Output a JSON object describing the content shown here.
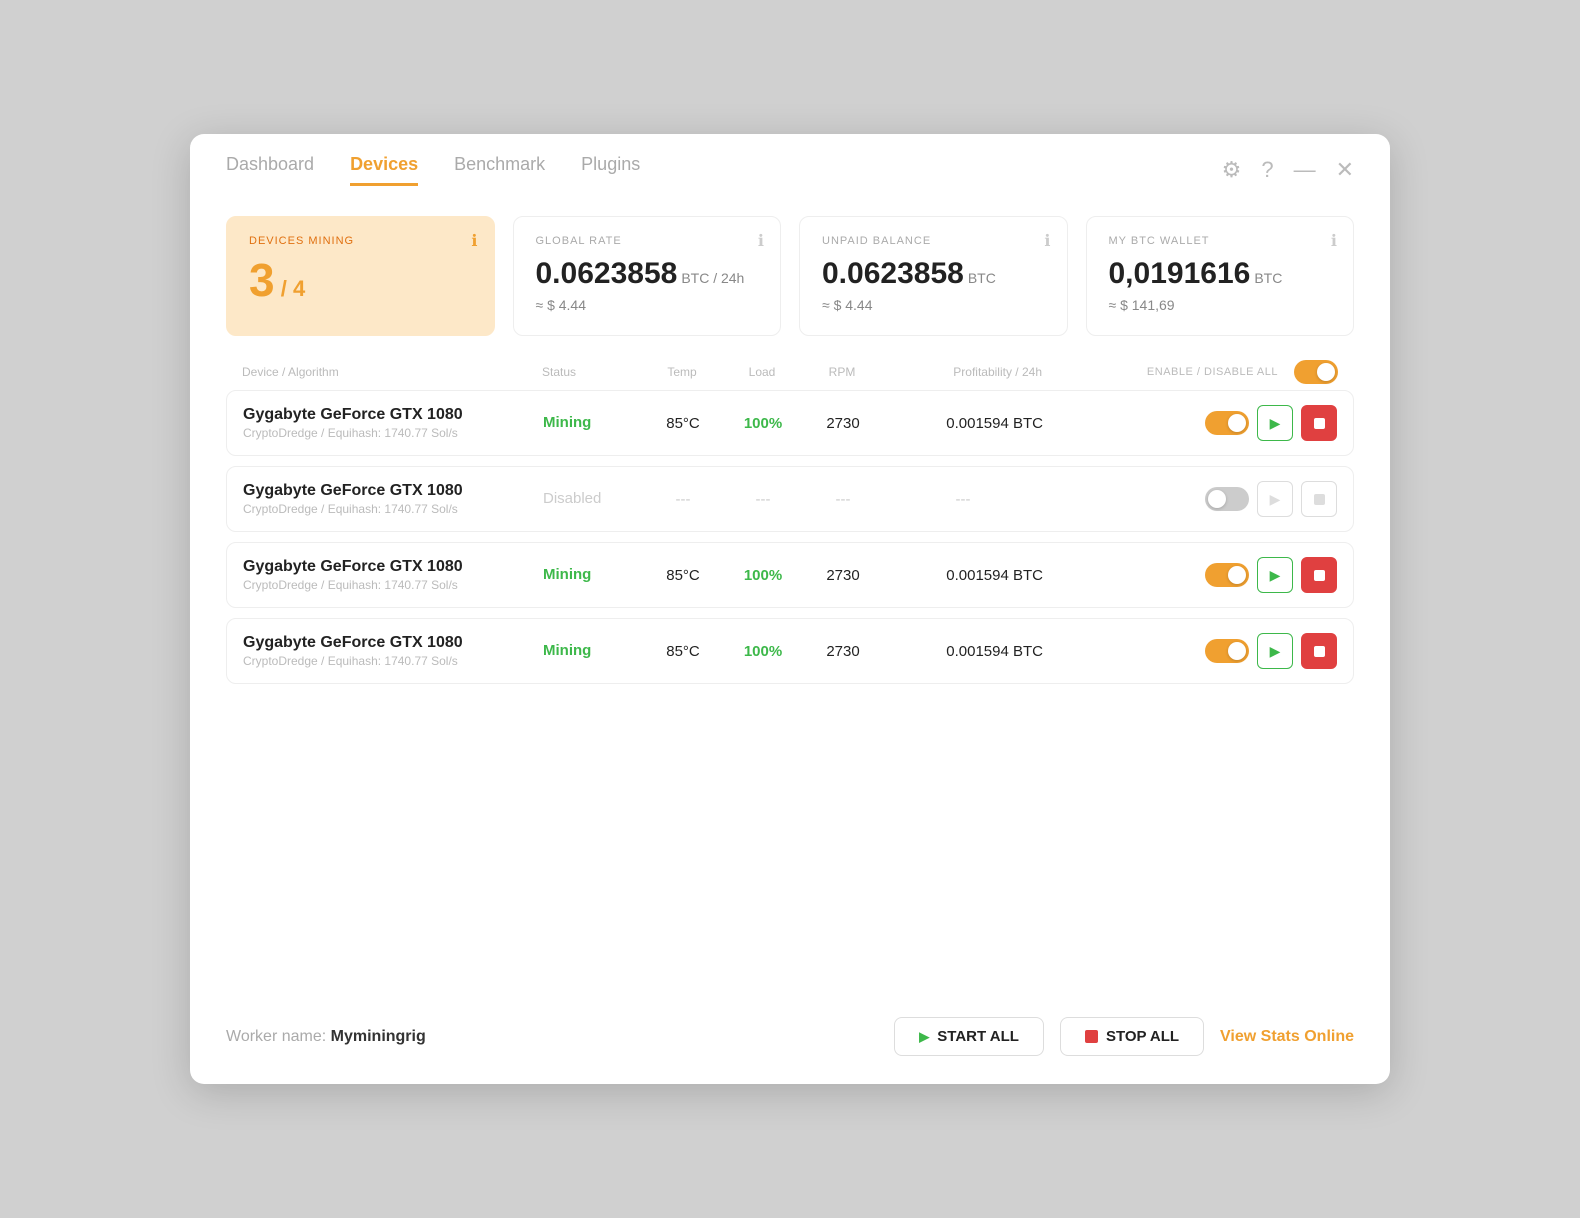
{
  "nav": {
    "tabs": [
      {
        "id": "dashboard",
        "label": "Dashboard",
        "active": false
      },
      {
        "id": "devices",
        "label": "Devices",
        "active": true
      },
      {
        "id": "benchmark",
        "label": "Benchmark",
        "active": false
      },
      {
        "id": "plugins",
        "label": "Plugins",
        "active": false
      }
    ]
  },
  "titleActions": {
    "settings": "⚙",
    "help": "?",
    "minimize": "—",
    "close": "✕"
  },
  "stats": {
    "devicesMining": {
      "label": "DEVICES MINING",
      "active": "3",
      "total": "4"
    },
    "globalRate": {
      "label": "GLOBAL RATE",
      "value": "0.0623858",
      "unit": "BTC / 24h",
      "sub": "≈ $ 4.44"
    },
    "unpaidBalance": {
      "label": "UNPAID BALANCE",
      "value": "0.0623858",
      "unit": "BTC",
      "sub": "≈ $ 4.44"
    },
    "btcWallet": {
      "label": "MY BTC WALLET",
      "value": "0,0191616",
      "unit": "BTC",
      "sub": "≈ $ 141,69"
    }
  },
  "tableHeader": {
    "device": "Device / Algorithm",
    "status": "Status",
    "temp": "Temp",
    "load": "Load",
    "rpm": "RPM",
    "profit": "Profitability / 24h",
    "enableAll": "ENABLE / DISABLE ALL"
  },
  "devices": [
    {
      "name": "Gygabyte GeForce GTX 1080",
      "algo": "CryptoDredge / Equihash: 1740.77 Sol/s",
      "status": "Mining",
      "statusType": "mining",
      "temp": "85°C",
      "load": "100%",
      "rpm": "2730",
      "profit": "0.001594 BTC",
      "enabled": true,
      "playActive": true,
      "stopActive": true
    },
    {
      "name": "Gygabyte GeForce GTX 1080",
      "algo": "CryptoDredge / Equihash: 1740.77 Sol/s",
      "status": "Disabled",
      "statusType": "disabled",
      "temp": "---",
      "load": "---",
      "rpm": "---",
      "profit": "---",
      "enabled": false,
      "playActive": false,
      "stopActive": false
    },
    {
      "name": "Gygabyte GeForce GTX 1080",
      "algo": "CryptoDredge / Equihash: 1740.77 Sol/s",
      "status": "Mining",
      "statusType": "mining",
      "temp": "85°C",
      "load": "100%",
      "rpm": "2730",
      "profit": "0.001594 BTC",
      "enabled": true,
      "playActive": true,
      "stopActive": true
    },
    {
      "name": "Gygabyte GeForce GTX 1080",
      "algo": "CryptoDredge / Equihash: 1740.77 Sol/s",
      "status": "Mining",
      "statusType": "mining",
      "temp": "85°C",
      "load": "100%",
      "rpm": "2730",
      "profit": "0.001594 BTC",
      "enabled": true,
      "playActive": true,
      "stopActive": true
    }
  ],
  "footer": {
    "workerLabel": "Worker name:",
    "workerName": "Myminingrig",
    "startAll": "START ALL",
    "stopAll": "STOP ALL",
    "viewStats": "View Stats Online"
  }
}
